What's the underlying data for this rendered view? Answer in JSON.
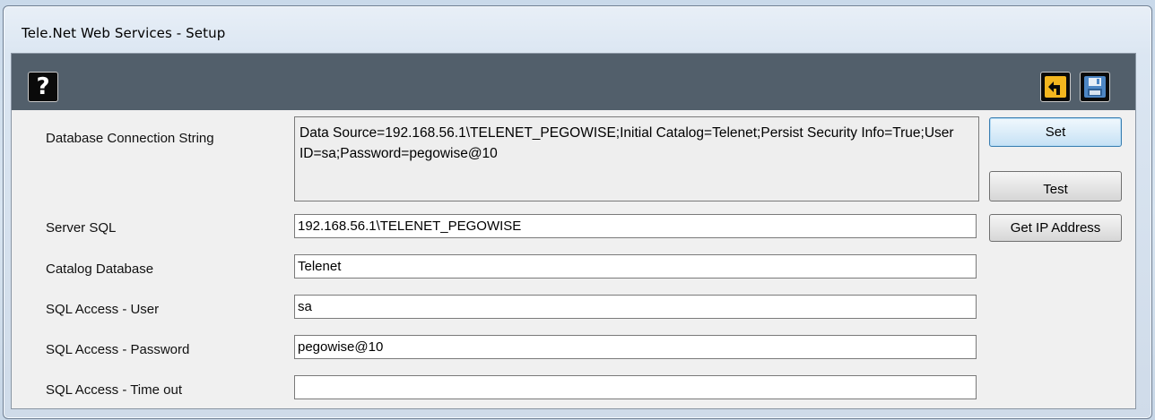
{
  "window": {
    "title": "Tele.Net Web Services - Setup"
  },
  "toolbar": {
    "help_icon": "help-question-icon",
    "help_glyph": "?",
    "undo_icon": "undo-arrow-icon",
    "save_icon": "floppy-disk-save-icon"
  },
  "form": {
    "connection_string": {
      "label": "Database Connection String",
      "value": "Data Source=192.168.56.1\\TELENET_PEGOWISE;Initial Catalog=Telenet;Persist Security Info=True;User ID=sa;Password=pegowise@10"
    },
    "server_sql": {
      "label": "Server SQL",
      "value": "192.168.56.1\\TELENET_PEGOWISE"
    },
    "catalog_database": {
      "label": "Catalog Database",
      "value": "Telenet"
    },
    "sql_user": {
      "label": "SQL Access - User",
      "value": "sa"
    },
    "sql_password": {
      "label": "SQL Access - Password",
      "value": "pegowise@10"
    },
    "sql_timeout": {
      "label": "SQL Access - Time out",
      "value": ""
    }
  },
  "buttons": {
    "set_label": "Set",
    "test_label": "Test",
    "get_ip_label": "Get IP Address"
  },
  "colors": {
    "toolbar_bg": "#525f6b",
    "client_bg": "#f0f0f0",
    "undo_accent": "#f3b61f",
    "save_accent": "#4d86c4"
  }
}
